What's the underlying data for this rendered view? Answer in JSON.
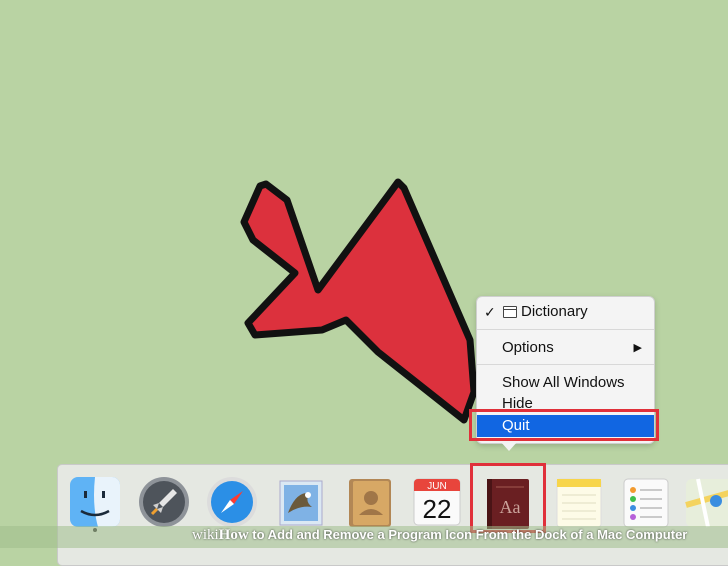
{
  "context_menu": {
    "app_checkmark": "✓",
    "app_name": "Dictionary",
    "options_label": "Options",
    "options_arrow": "▶",
    "show_all_windows_label": "Show All Windows",
    "hide_label": "Hide",
    "quit_label": "Quit"
  },
  "dock": {
    "items": [
      {
        "name": "finder-icon",
        "running": true
      },
      {
        "name": "launchpad-icon",
        "running": false
      },
      {
        "name": "safari-icon",
        "running": false
      },
      {
        "name": "mail-icon",
        "running": false
      },
      {
        "name": "contacts-icon",
        "running": false
      },
      {
        "name": "calendar-icon",
        "running": false
      },
      {
        "name": "dictionary-icon",
        "running": true
      },
      {
        "name": "notes-icon",
        "running": false
      },
      {
        "name": "reminders-icon",
        "running": false
      },
      {
        "name": "maps-icon",
        "running": false
      }
    ],
    "calendar_month": "JUN",
    "calendar_day": "22",
    "dictionary_glyph": "Aa"
  },
  "banner": {
    "wiki": "wiki",
    "how": "How",
    "title": " to Add and Remove a Program Icon From the Dock of a Mac Computer"
  },
  "colors": {
    "desktop": "#b9d3a3",
    "annotation_red": "#e0303a",
    "selection_blue": "#1166e2"
  }
}
